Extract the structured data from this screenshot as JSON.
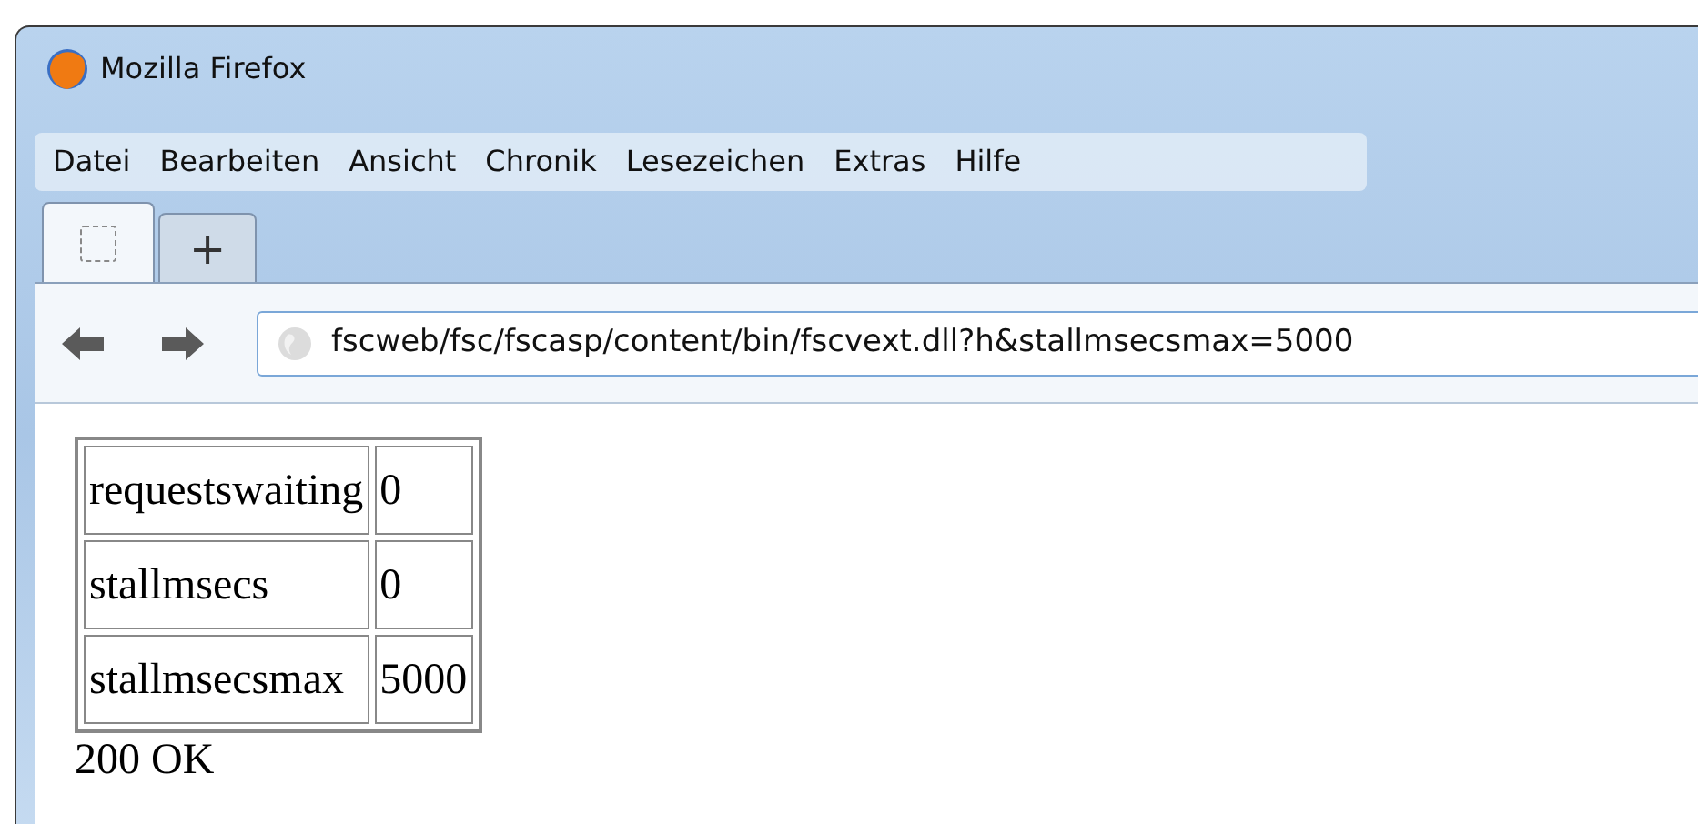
{
  "window": {
    "title": "Mozilla Firefox"
  },
  "menu": [
    {
      "label": "Datei"
    },
    {
      "label": "Bearbeiten"
    },
    {
      "label": "Ansicht"
    },
    {
      "label": "Chronik"
    },
    {
      "label": "Lesezeichen"
    },
    {
      "label": "Extras"
    },
    {
      "label": "Hilfe"
    }
  ],
  "tabs": [
    {
      "kind": "page",
      "selected": true
    },
    {
      "kind": "new",
      "label": "+",
      "selected": false
    }
  ],
  "address_bar": {
    "value": "fscweb/fsc/fscasp/content/bin/fscvext.dll?h&stallmsecsmax=5000"
  },
  "table": {
    "rows": [
      [
        "requestswaiting",
        "0"
      ],
      [
        "stallmsecs",
        "0"
      ],
      [
        "stallmsecsmax",
        "5000"
      ]
    ]
  },
  "status_text": "200 OK"
}
